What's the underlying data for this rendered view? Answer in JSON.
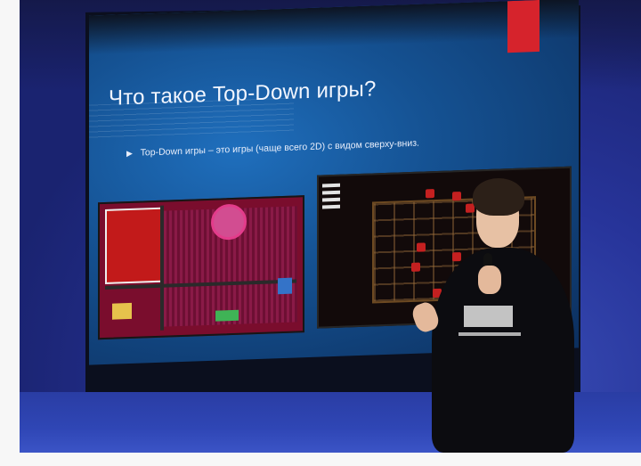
{
  "slide": {
    "title": "Что такое Top-Down игры?",
    "bullet": "Top-Down игры – это игры (чаще всего 2D) с видом сверху-вниз."
  }
}
